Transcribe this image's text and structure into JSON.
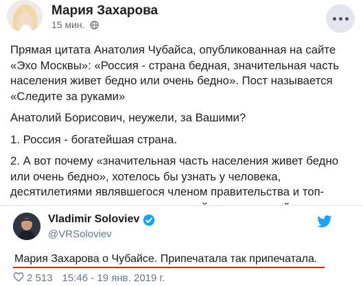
{
  "post": {
    "author": "Мария Захарова",
    "time": "15 мин.",
    "paragraphs": [
      "Прямая цитата Анатолия Чубайса, опубликованная на сайте «Эхо Москвы»: «Россия - страна бедная, значительная часть населения живет бедно или очень бедно». Пост называется «Следите за руками»",
      "Анатолий Борисович, неужели, за Вашими?",
      "1. Россия - богатейшая страна.",
      "2. А вот почему «значительная часть населения живет бедно или очень бедно», хотелось бы узнать у человека, десятилетиями являвшегося членом правительства и топ-менеджером ключевых направлений отечественной"
    ]
  },
  "tweet": {
    "name": "Vladimir Soloviev",
    "handle": "@VRSoloviev",
    "text": "Мария Захарова о Чубайсе.  Припечатала так припечатала.",
    "likes": "2 513",
    "timestamp": "15:46 - 19 янв. 2019 г."
  },
  "colors": {
    "underline": "#e41919",
    "twitter_blue": "#1da1f2",
    "meta_gray": "#65676b"
  },
  "icons": {
    "privacy": "globe-icon",
    "options": "more-options-icon",
    "verified": "verified-badge-icon",
    "brand": "twitter-bird-icon",
    "like": "heart-icon"
  }
}
